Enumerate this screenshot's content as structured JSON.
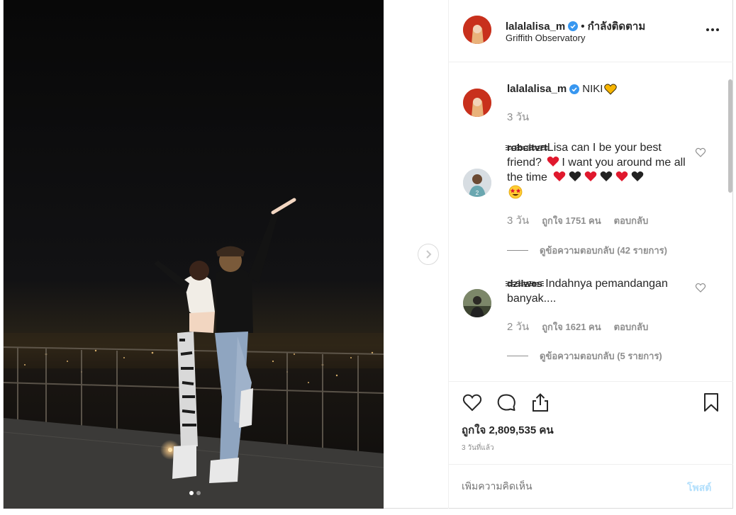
{
  "post": {
    "username": "lalalalisa_m",
    "follow_status": "• กำลังติดตาม",
    "location": "Griffith Observatory",
    "caption": "NIKI",
    "caption_time": "3 วัน",
    "accent_color": "#3897f0",
    "likes_text": "ถูกใจ 2,809,535 คน",
    "posted_ago": "3 วันที่แล้ว"
  },
  "comments": [
    {
      "username": "robcitvrt",
      "text_before": "Lisa can I be your best friend?",
      "text_after": "I want you around me all the time",
      "emoji": [
        "red-heart",
        "black-heart",
        "red-heart",
        "black-heart",
        "red-heart",
        "black-heart",
        "star-eyes"
      ],
      "time": "3 วัน",
      "likes": "ถูกใจ 1751 คน",
      "reply_label": "ตอบกลับ",
      "view_replies": "ดูข้อความตอบกลับ (42 รายการ)"
    },
    {
      "username": "dzilwes",
      "text": "Indahnya pemandangan banyak....",
      "time": "2 วัน",
      "likes": "ถูกใจ 1621 คน",
      "reply_label": "ตอบกลับ",
      "view_replies": "ดูข้อความตอบกลับ (5 รายการ)"
    }
  ],
  "add_comment": {
    "placeholder": "เพิ่มความคิดเห็น",
    "post_label": "โพสต์"
  },
  "gallery": {
    "current": 1,
    "total": 2
  },
  "icons": [
    "more-icon",
    "verified-icon",
    "like-icon",
    "comment-icon",
    "share-icon",
    "save-icon",
    "next-chevron-icon"
  ]
}
